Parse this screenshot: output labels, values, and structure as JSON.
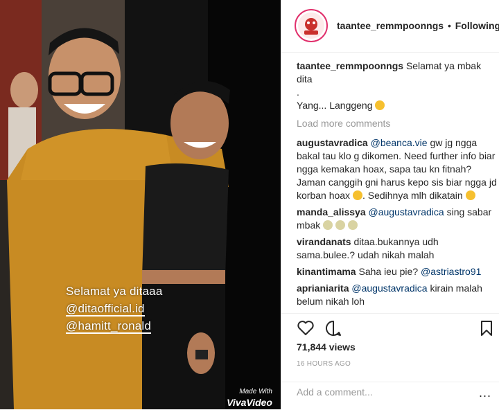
{
  "media": {
    "overlay_line1": "Selamat ya ditaaa",
    "overlay_line2": "@ditaofficial.id",
    "overlay_line3": "@hamitt_ronald",
    "watermark_small": "Made With",
    "watermark_brand": "VivaVideo"
  },
  "header": {
    "username": "taantee_remmpoonngs",
    "separator": "•",
    "follow_status": "Following",
    "avatar_icon": "profile-avatar-icon"
  },
  "caption": {
    "username": "taantee_remmpoonngs",
    "line1": "Selamat ya mbak dita",
    "line2": ".",
    "line3": "Yang... Langgeng"
  },
  "load_more": "Load more comments",
  "comments": [
    {
      "user": "augustavradica",
      "mention": "@beanca.vie",
      "text1": "gw jg ngga bakal tau klo g dikomen. Need further info biar ngga kemakan hoax, sapa tau kn fitnah? Jaman canggih gni harus kepo sis biar ngga jd korban hoax",
      "text2": ". Sedihnya mlh dikatain"
    },
    {
      "user": "manda_alissya",
      "mention": "@augustavradica",
      "text1": "sing sabar mbak"
    },
    {
      "user": "virandanats",
      "text1": "ditaa.bukannya udh sama.bulee.? udah nikah malah"
    },
    {
      "user": "kinantimama",
      "text1": "Saha ieu pie?",
      "mention_after": "@astriastro91"
    },
    {
      "user": "aprianiarita",
      "mention": "@augustavradica",
      "text1": "kirain malah belum nikah loh"
    }
  ],
  "actions": {
    "like_icon": "heart-icon",
    "comment_icon": "comment-bubble-icon",
    "save_icon": "bookmark-icon",
    "views": "71,844 views",
    "timestamp": "16 HOURS AGO"
  },
  "add_comment": {
    "placeholder": "Add a comment...",
    "more": "..."
  }
}
